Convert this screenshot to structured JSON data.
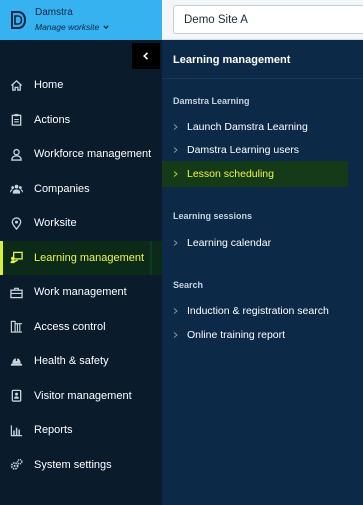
{
  "brand": {
    "name": "Damstra",
    "subtitle": "Manage worksite"
  },
  "topbar": {
    "site": "Demo Site A"
  },
  "sidebar": {
    "items": [
      {
        "label": "Home",
        "icon": "home-icon"
      },
      {
        "label": "Actions",
        "icon": "clipboard-icon"
      },
      {
        "label": "Workforce management",
        "icon": "user-icon"
      },
      {
        "label": "Companies",
        "icon": "people-group-icon"
      },
      {
        "label": "Worksite",
        "icon": "map-pin-icon"
      },
      {
        "label": "Learning management",
        "icon": "learning-icon",
        "active": true
      },
      {
        "label": "Work management",
        "icon": "toolbox-icon"
      },
      {
        "label": "Access control",
        "icon": "gate-icon"
      },
      {
        "label": "Health & safety",
        "icon": "hard-hat-icon"
      },
      {
        "label": "Visitor management",
        "icon": "visitor-badge-icon"
      },
      {
        "label": "Reports",
        "icon": "bar-chart-icon"
      },
      {
        "label": "System settings",
        "icon": "settings-cogs-icon"
      }
    ]
  },
  "panel": {
    "title": "Learning management",
    "sections": [
      {
        "label": "Damstra Learning",
        "items": [
          "Launch Damstra Learning",
          "Damstra Learning users",
          "Lesson scheduling"
        ]
      },
      {
        "label": "Learning sessions",
        "items": [
          "Learning calendar"
        ]
      },
      {
        "label": "Search",
        "items": [
          "Induction & registration search",
          "Online training report"
        ]
      }
    ],
    "active_item": "Lesson scheduling"
  },
  "colors": {
    "brand_blue": "#37b2f0",
    "sidebar_bg": "#0a1b2c",
    "panel_bg": "#0c2a47",
    "active_text": "#eaf74a",
    "active_accent": "#d7ef3a"
  }
}
